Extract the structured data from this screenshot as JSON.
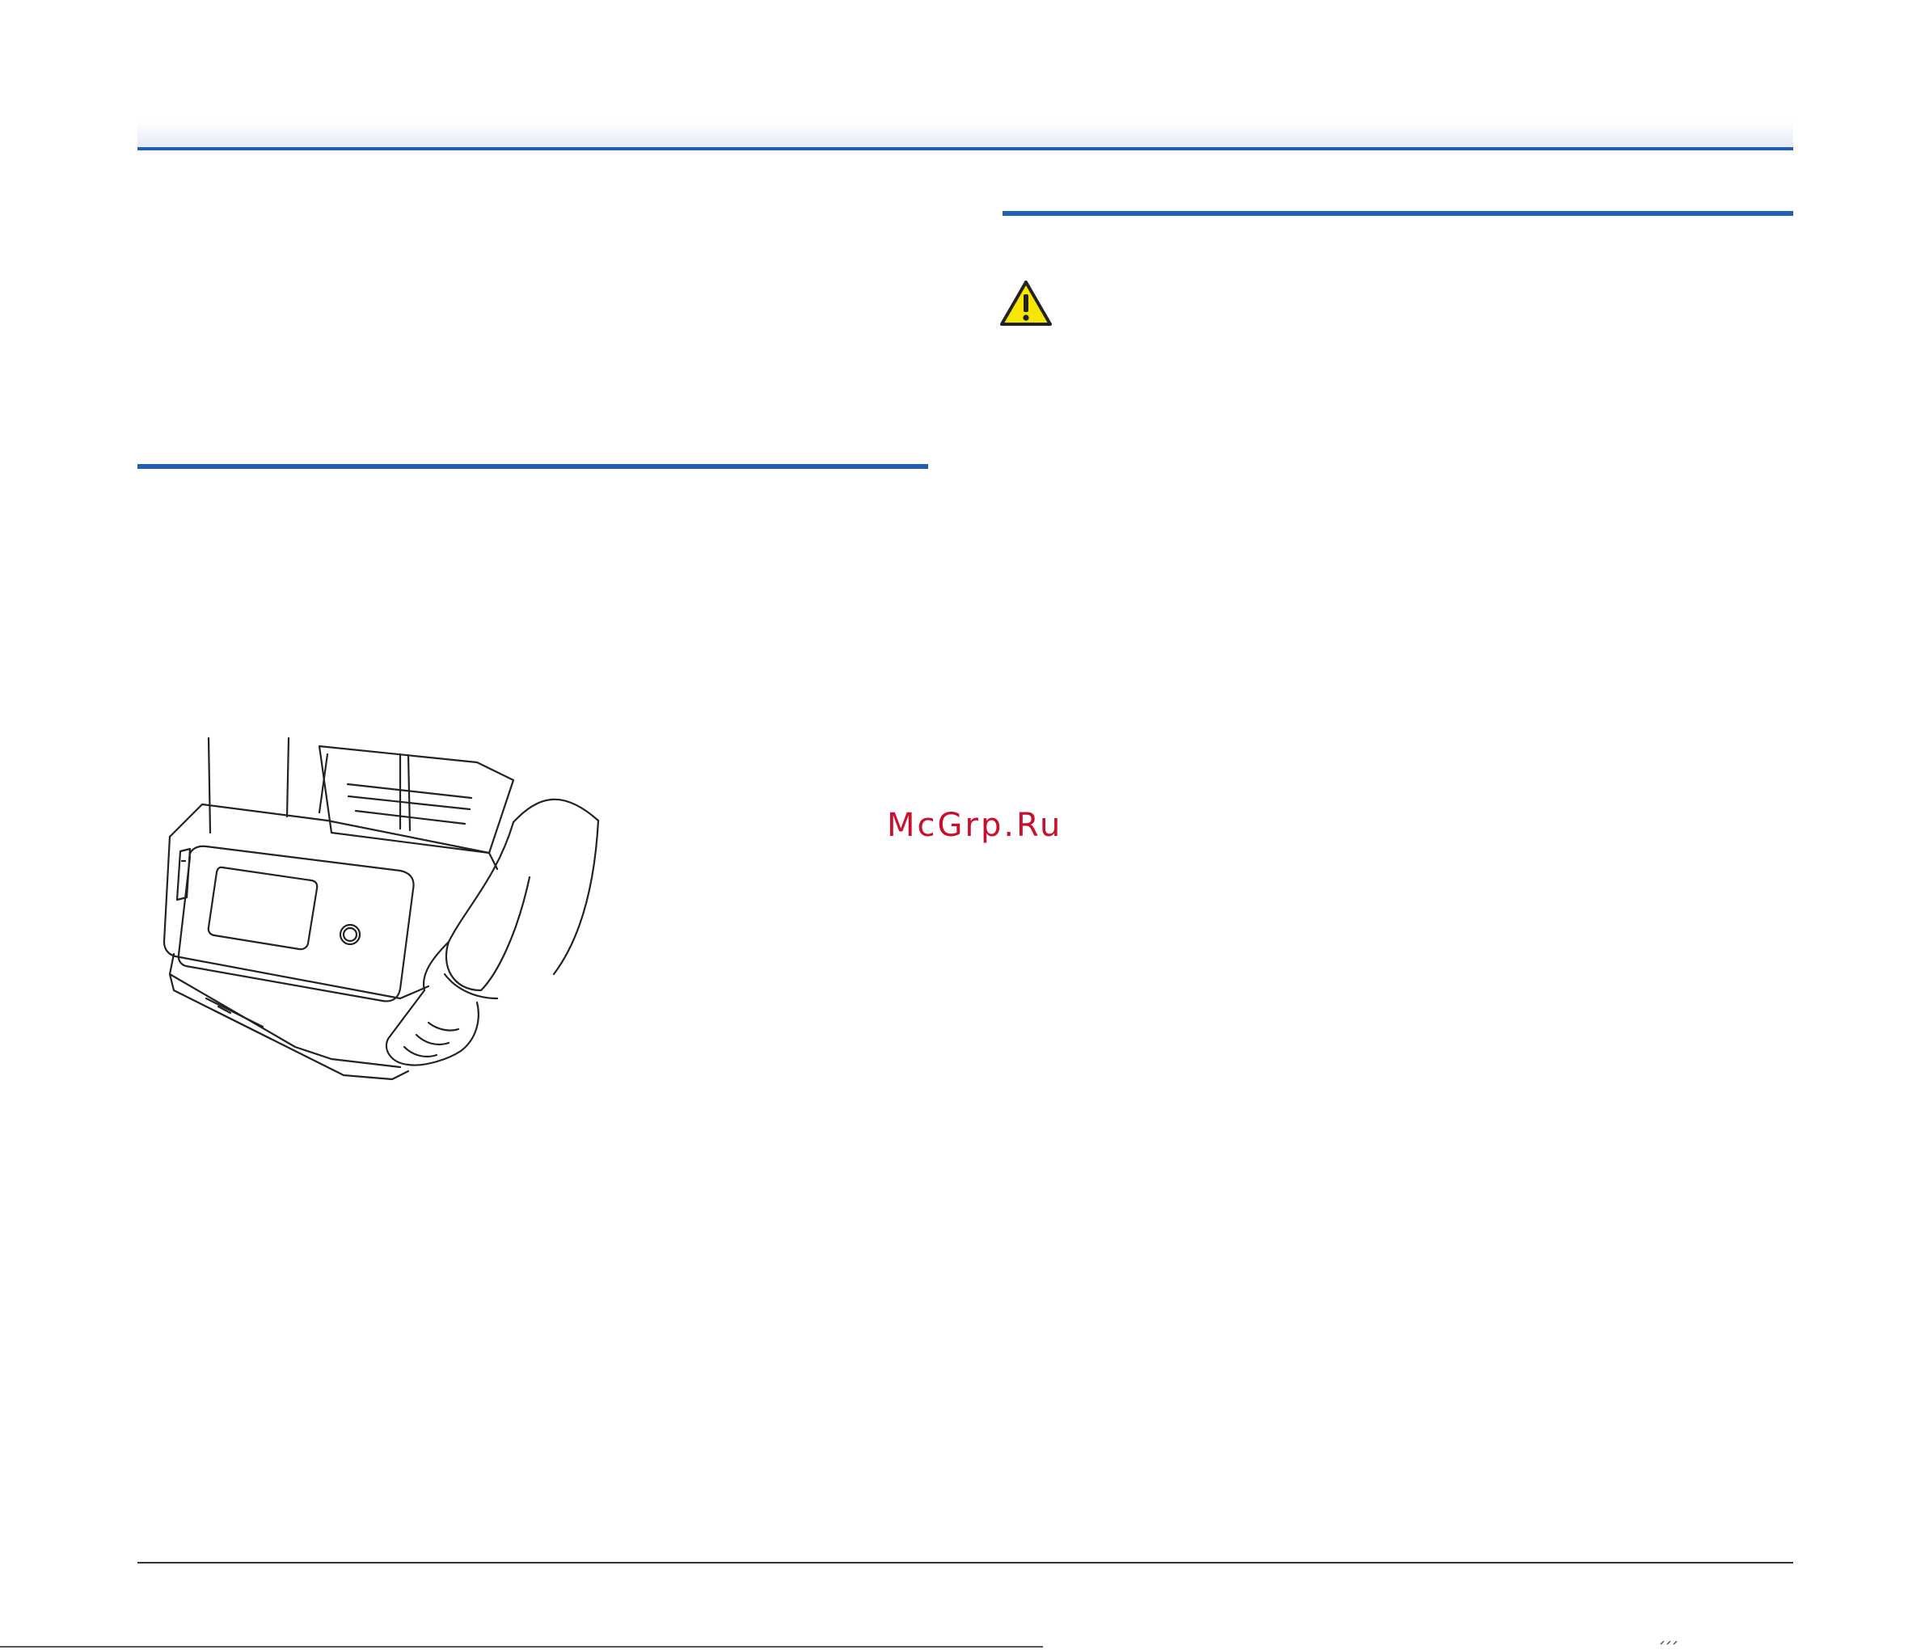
{
  "watermark": {
    "text": "McGrp.Ru",
    "color": "#c8102e"
  },
  "colors": {
    "accent_rule": "#1f5fae",
    "warning_fill": "#f7e600",
    "line_art": "#222222"
  },
  "icons": {
    "caution": "warning-triangle-icon"
  },
  "figure": {
    "subject": "scanner-carried-by-hands"
  }
}
